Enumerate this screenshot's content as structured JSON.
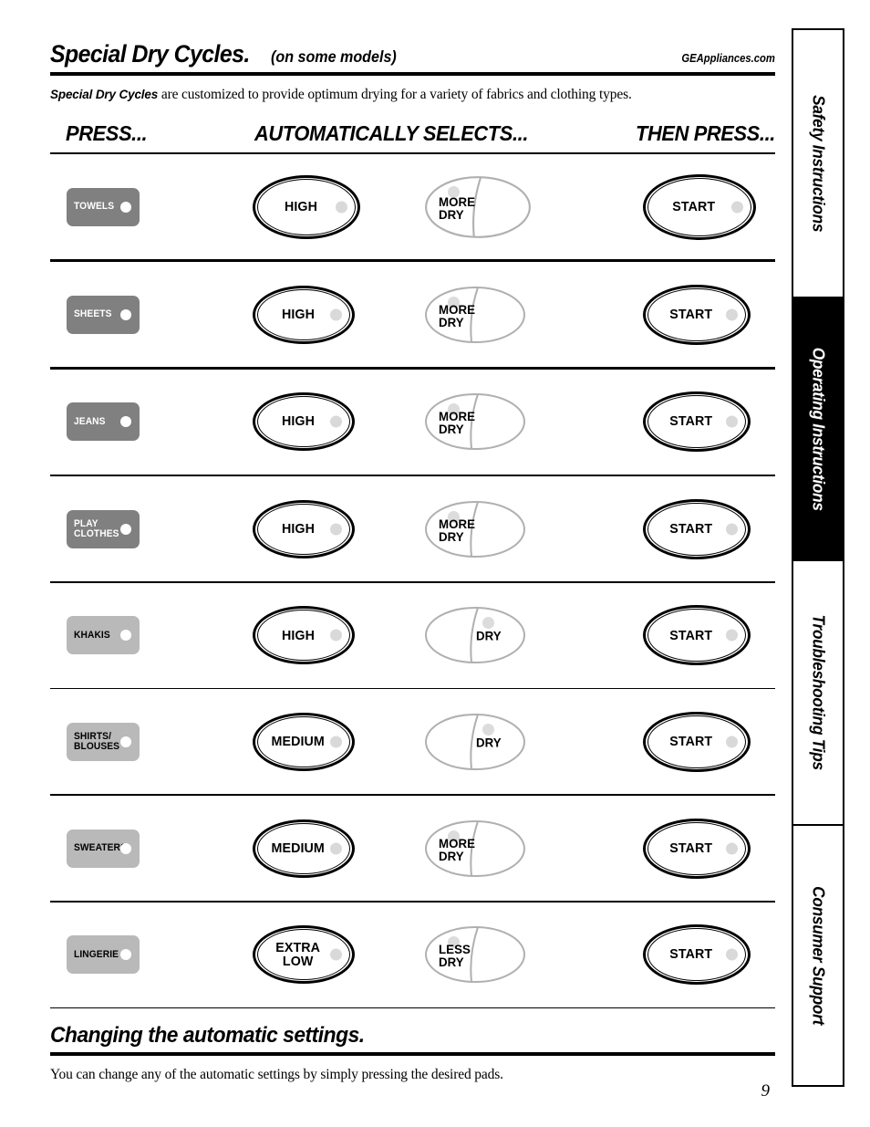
{
  "header": {
    "title": "Special Dry Cycles.",
    "subtitle": "(on some models)",
    "site_url": "GEAppliances.com",
    "intro_bold": "Special Dry Cycles",
    "intro_rest": " are customized to provide optimum drying for a variety of fabrics and clothing types."
  },
  "columns": {
    "press": "PRESS...",
    "automatically_selects": "AUTOMATICALLY SELECTS...",
    "then_press": "THEN PRESS..."
  },
  "rows": [
    {
      "cycle": "TOWELS",
      "cycle_shade": "dark",
      "temperature": "HIGH",
      "dryness": "MORE\nDRY",
      "dryness_side": "left",
      "start": "START"
    },
    {
      "cycle": "SHEETS",
      "cycle_shade": "dark",
      "temperature": "HIGH",
      "dryness": "MORE\nDRY",
      "dryness_side": "left",
      "start": "START"
    },
    {
      "cycle": "JEANS",
      "cycle_shade": "dark",
      "temperature": "HIGH",
      "dryness": "MORE\nDRY",
      "dryness_side": "left",
      "start": "START"
    },
    {
      "cycle": "PLAY\nCLOTHES",
      "cycle_shade": "dark",
      "temperature": "HIGH",
      "dryness": "MORE\nDRY",
      "dryness_side": "left",
      "start": "START"
    },
    {
      "cycle": "KHAKIS",
      "cycle_shade": "light",
      "temperature": "HIGH",
      "dryness": "DRY",
      "dryness_side": "right",
      "start": "START"
    },
    {
      "cycle": "SHIRTS/\nBLOUSES",
      "cycle_shade": "light",
      "temperature": "MEDIUM",
      "dryness": "DRY",
      "dryness_side": "right",
      "start": "START"
    },
    {
      "cycle": "SWEATERS",
      "cycle_shade": "light",
      "temperature": "MEDIUM",
      "dryness": "MORE\nDRY",
      "dryness_side": "left",
      "start": "START"
    },
    {
      "cycle": "LINGERIE",
      "cycle_shade": "light",
      "temperature": "EXTRA\nLOW",
      "dryness": "LESS\nDRY",
      "dryness_side": "left",
      "start": "START"
    }
  ],
  "footer": {
    "title": "Changing the automatic settings.",
    "text": "You can change any of the automatic settings by simply pressing the desired pads.",
    "page_number": "9"
  },
  "sidebar": {
    "tabs": [
      {
        "label": "Safety Instructions",
        "active": false
      },
      {
        "label": "Operating Instructions",
        "active": true
      },
      {
        "label": "Troubleshooting Tips",
        "active": false
      },
      {
        "label": "Consumer Support",
        "active": false
      }
    ]
  },
  "colors": {
    "pad_dark": "#808080",
    "pad_light": "#b9b9b9",
    "led_white": "#ffffff",
    "led_gray": "#d9d9d9",
    "dial_outline": "#b0b0b0",
    "ink": "#000000"
  }
}
